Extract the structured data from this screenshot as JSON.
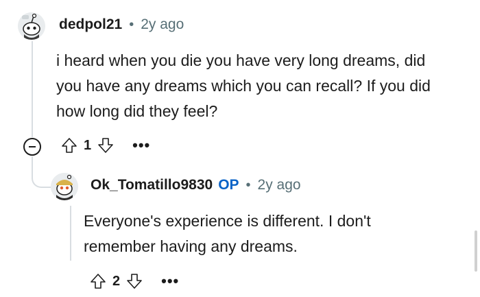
{
  "comments": [
    {
      "username": "dedpol21",
      "separator": "•",
      "time": "2y ago",
      "body": "i heard when you die you have very long dreams, did you have any dreams which you can recall? If you did how long did they feel?",
      "score": "1",
      "avatar_icon": "snoo-avatar-icon"
    },
    {
      "username": "Ok_Tomatillo9830",
      "op_badge": "OP",
      "separator": "•",
      "time": "2y ago",
      "body": "Everyone's experience is different. I don't remember having any dreams.",
      "score": "2",
      "avatar_icon": "snoo-avatar-icon"
    }
  ],
  "icons": {
    "upvote": "upvote-arrow-icon",
    "downvote": "downvote-arrow-icon",
    "more": "more-options-icon",
    "collapse": "collapse-thread-icon"
  },
  "colors": {
    "op_badge": "#0a63c7",
    "meta_gray": "#576f76",
    "thread_line": "#d8dde1"
  }
}
